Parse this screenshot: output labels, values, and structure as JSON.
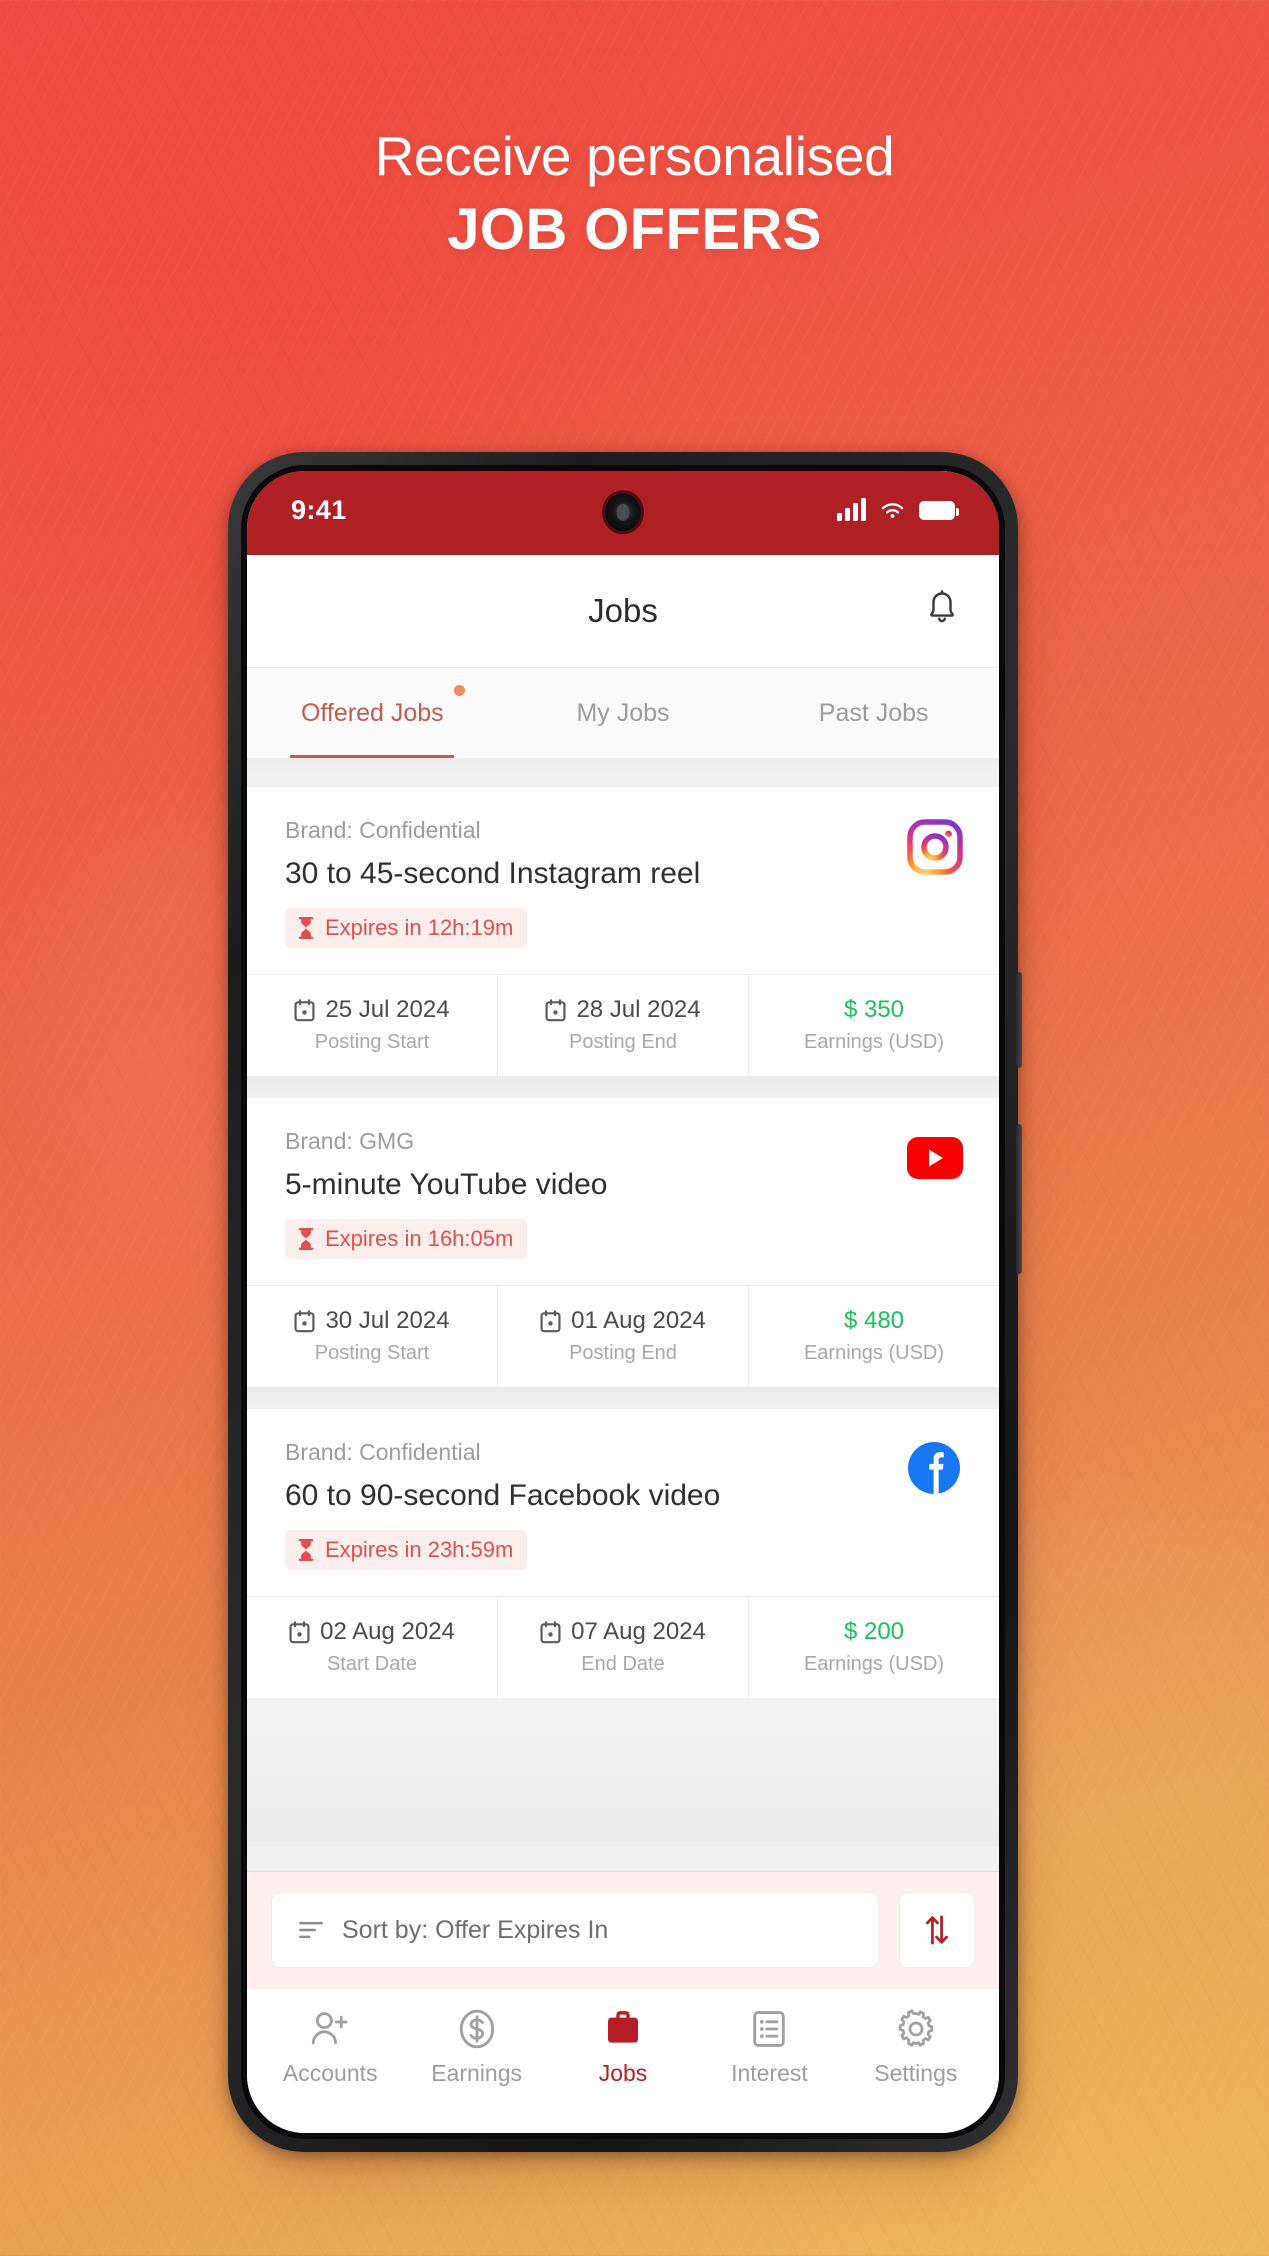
{
  "promo": {
    "line1": "Receive personalised",
    "line2": "JOB OFFERS"
  },
  "theme": {
    "accent_red": "#b41f26",
    "tab_active": "#c25b52",
    "expire_text": "#e0504f",
    "expire_bg": "#fdeeee",
    "money_green": "#1ac05a",
    "badge_dot": "#ef8b5e",
    "status_bar_bg": "#ad2024"
  },
  "statusbar": {
    "time": "9:41",
    "signal_icon": "cellular-signal-icon",
    "wifi_icon": "wifi-icon",
    "battery_icon": "battery-full-icon",
    "camera_icon": "front-camera-icon"
  },
  "header": {
    "title": "Jobs",
    "notifications_icon": "bell-icon"
  },
  "tabs": [
    {
      "label": "Offered Jobs",
      "active": true,
      "has_badge": true
    },
    {
      "label": "My Jobs",
      "active": false,
      "has_badge": false
    },
    {
      "label": "Past Jobs",
      "active": false,
      "has_badge": false
    }
  ],
  "jobs": [
    {
      "brand": "Brand: Confidential",
      "title": "30 to 45-second Instagram reel",
      "expires": "Expires in 12h:19m",
      "expires_icon": "hourglass-icon",
      "platform_icon": "instagram-icon",
      "meta": [
        {
          "icon": "calendar-icon",
          "value": "25 Jul 2024",
          "label": "Posting Start"
        },
        {
          "icon": "calendar-icon",
          "value": "28 Jul 2024",
          "label": "Posting End"
        },
        {
          "icon": "",
          "value": "$ 350",
          "label": "Earnings (USD)",
          "money": true
        }
      ]
    },
    {
      "brand": "Brand: GMG",
      "title": "5-minute YouTube video",
      "expires": "Expires in 16h:05m",
      "expires_icon": "hourglass-icon",
      "platform_icon": "youtube-icon",
      "meta": [
        {
          "icon": "calendar-icon",
          "value": "30 Jul 2024",
          "label": "Posting Start"
        },
        {
          "icon": "calendar-icon",
          "value": "01 Aug 2024",
          "label": "Posting End"
        },
        {
          "icon": "",
          "value": "$ 480",
          "label": "Earnings (USD)",
          "money": true
        }
      ]
    },
    {
      "brand": "Brand: Confidential",
      "title": "60 to 90-second Facebook video",
      "expires": "Expires in 23h:59m",
      "expires_icon": "hourglass-icon",
      "platform_icon": "facebook-icon",
      "meta": [
        {
          "icon": "calendar-icon",
          "value": "02 Aug 2024",
          "label": "Start Date"
        },
        {
          "icon": "calendar-icon",
          "value": "07 Aug 2024",
          "label": "End Date"
        },
        {
          "icon": "",
          "value": "$ 200",
          "label": "Earnings (USD)",
          "money": true
        }
      ]
    }
  ],
  "sortbar": {
    "sort_icon": "sort-lines-icon",
    "sort_label": "Sort by: Offer Expires In",
    "direction_icon": "sort-direction-arrows-icon"
  },
  "bottom_nav": [
    {
      "label": "Accounts",
      "icon": "user-add-icon",
      "active": false
    },
    {
      "label": "Earnings",
      "icon": "dollar-coin-icon",
      "active": false
    },
    {
      "label": "Jobs",
      "icon": "briefcase-icon",
      "active": true
    },
    {
      "label": "Interest",
      "icon": "list-document-icon",
      "active": false
    },
    {
      "label": "Settings",
      "icon": "gear-icon",
      "active": false
    }
  ]
}
